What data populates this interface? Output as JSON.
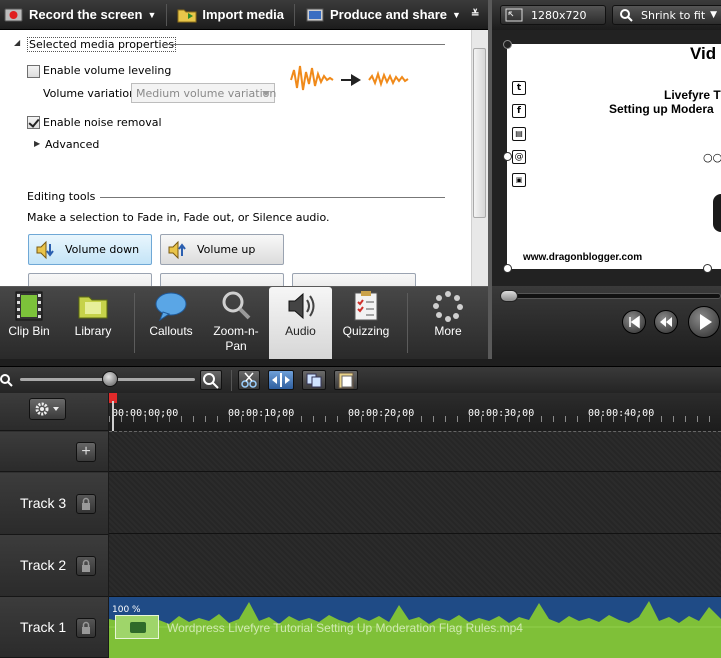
{
  "toolbar": {
    "record": "Record the screen",
    "import": "Import media",
    "produce": "Produce and share"
  },
  "preview_bar": {
    "dimensions": "1280x720",
    "zoom": "Shrink to fit"
  },
  "audio_panel": {
    "section_title": "Selected media properties",
    "volume_leveling": {
      "label": "Enable volume leveling",
      "checked": false
    },
    "volume_variation": {
      "label": "Volume variation:",
      "value": "Medium volume variation"
    },
    "noise_removal": {
      "label": "Enable noise removal",
      "checked": true
    },
    "advanced": "Advanced",
    "editing_title": "Editing tools",
    "editing_hint": "Make a selection to Fade in, Fade out, or Silence audio.",
    "volume_down": "Volume down",
    "volume_up": "Volume up"
  },
  "tools": [
    {
      "label": "Clip Bin"
    },
    {
      "label": "Library"
    },
    {
      "label": "Callouts"
    },
    {
      "label": "Zoom-n-Pan"
    },
    {
      "label": "Audio",
      "active": true
    },
    {
      "label": "Quizzing"
    },
    {
      "label": "More"
    }
  ],
  "preview_canvas": {
    "title": "Vid",
    "line1": "Livefyre T",
    "line2": "Setting up Modera",
    "site": "www.dragonblogger.com"
  },
  "ruler": {
    "ticks": [
      "00:00:00;00",
      "00:00:10;00",
      "00:00:20;00",
      "00:00:30;00",
      "00:00:40;00"
    ]
  },
  "tracks": [
    {
      "name": "Track 3"
    },
    {
      "name": "Track 2"
    },
    {
      "name": "Track 1"
    }
  ],
  "clip": {
    "title": "Wordpress Livefyre Tutorial Setting Up Moderation Flag Rules.mp4",
    "volume": "100 %"
  },
  "colors": {
    "clip_bg": "#1f4b86",
    "waveform": "#7fc038",
    "accent": "#6fa8d6"
  }
}
